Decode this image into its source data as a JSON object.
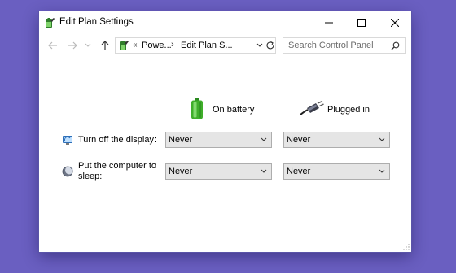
{
  "window": {
    "title": "Edit Plan Settings",
    "title_icon": "power-options-icon",
    "controls": [
      "minimize-icon",
      "maximize-icon",
      "close-icon"
    ]
  },
  "navigation": {
    "back_icon": "arrow-left-icon",
    "forward_icon": "arrow-right-icon",
    "recent_icon": "chevron-down-icon",
    "up_icon": "arrow-up-icon",
    "address": {
      "icon": "power-options-icon",
      "overflow": "«",
      "crumb_1": "Powe...",
      "separator": "›",
      "crumb_2": "Edit Plan S...",
      "dropdown_icon": "chevron-down-icon"
    },
    "refresh_icon": "refresh-icon",
    "search": {
      "placeholder": "Search Control Panel",
      "value": "",
      "icon": "search-icon"
    }
  },
  "columns": {
    "battery": {
      "label": "On battery",
      "icon": "battery-icon"
    },
    "plugged": {
      "label": "Plugged in",
      "icon": "power-plug-icon"
    }
  },
  "settings": [
    {
      "label": "Turn off the display:",
      "icon": "display-icon",
      "on_battery": "Never",
      "plugged_in": "Never"
    },
    {
      "label_line_1": "Put the computer to",
      "label_line_2": "sleep:",
      "icon": "moon-icon",
      "on_battery": "Never",
      "plugged_in": "Never"
    }
  ],
  "colors": {
    "desktop": "#6a5fc1",
    "window_bg": "#ffffff",
    "dropdown_bg": "#e5e5e5",
    "dropdown_border": "#adadad",
    "battery_green": "#3fae2a"
  }
}
